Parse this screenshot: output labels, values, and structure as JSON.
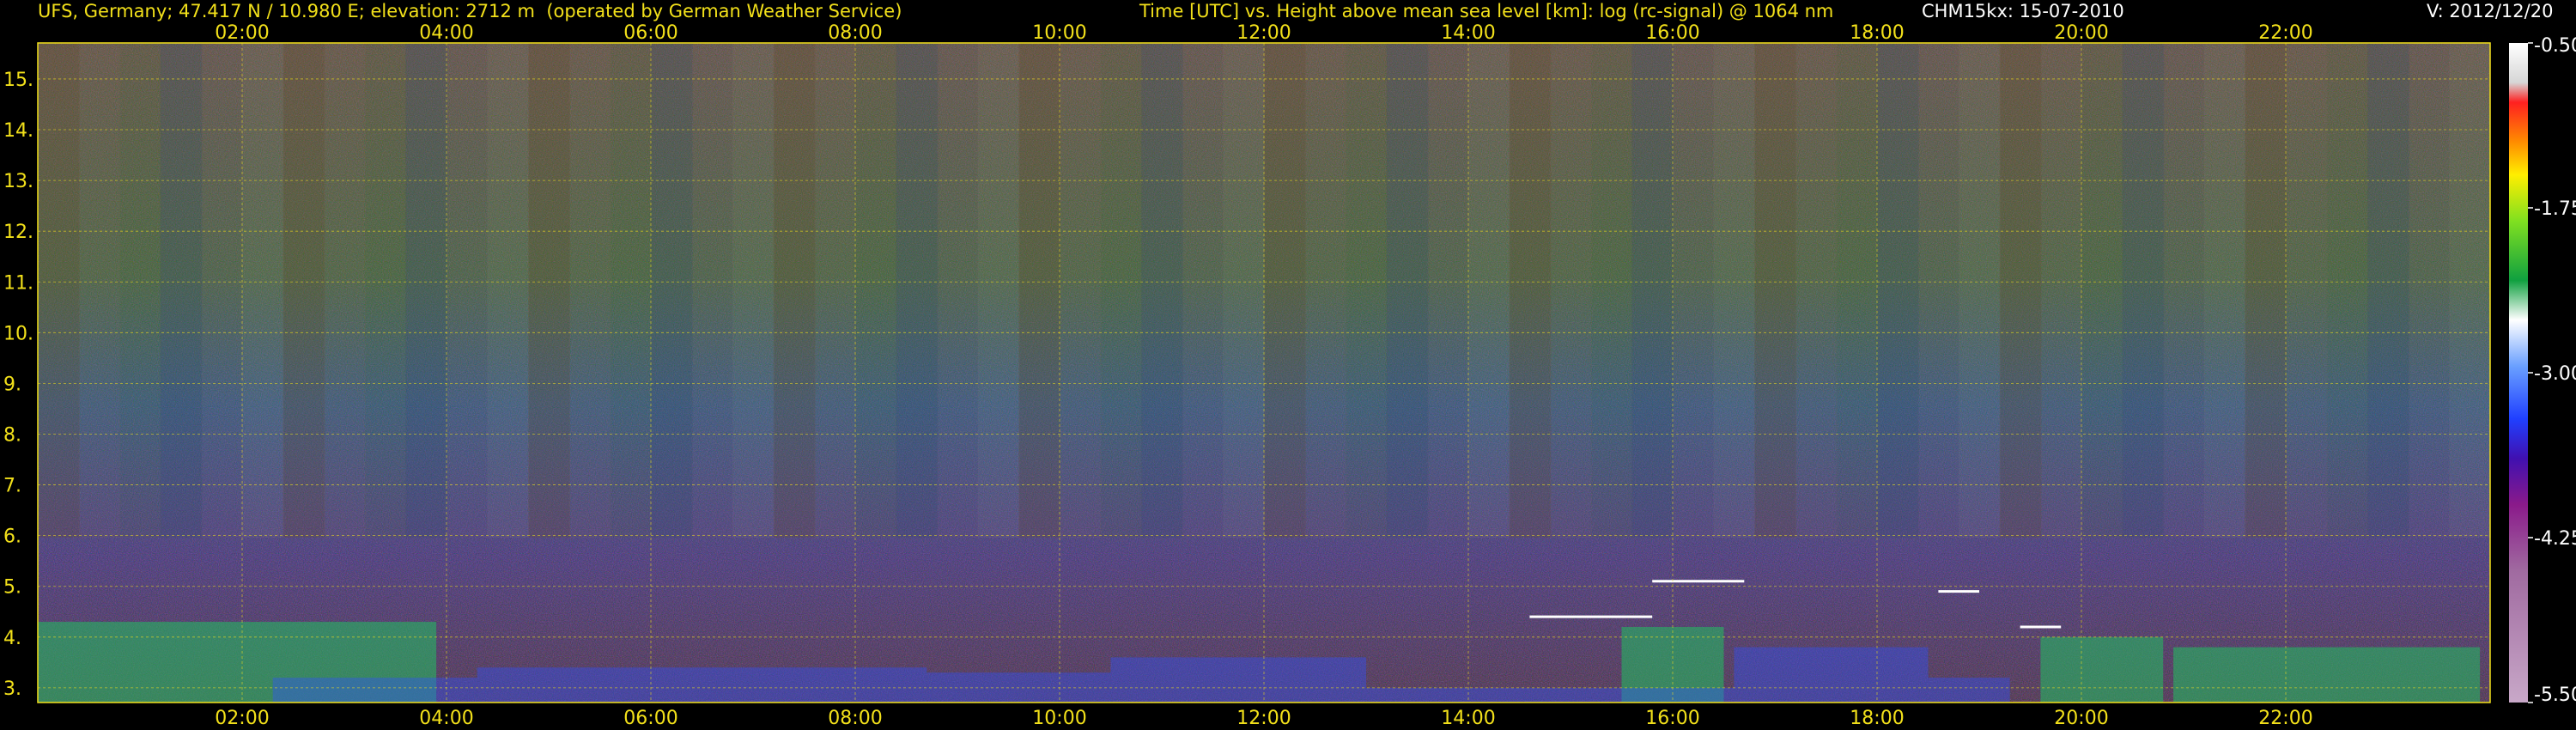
{
  "header": {
    "station": "UFS, Germany; 47.417 N / 10.980 E; elevation: 2712 m  (operated by German Weather Service)",
    "title": "Time [UTC] vs. Height above mean sea level [km]: log (rc-signal) @ 1064 nm",
    "instrument": "CHM15kx: 15-07-2010",
    "version": "V: 2012/12/20"
  },
  "colors": {
    "text": "#f2e01a",
    "frame": "#f2e01a",
    "background": "#000000"
  },
  "chart_data": {
    "type": "heatmap",
    "title": "Time [UTC] vs. Height above mean sea level [km]: log (rc-signal) @ 1064 nm",
    "x_unit": "hours UTC",
    "y_unit": "km",
    "xlim": [
      0.0,
      24.0
    ],
    "ylim": [
      2.71,
      15.71
    ],
    "x_ticks": [
      2,
      4,
      6,
      8,
      10,
      12,
      14,
      16,
      18,
      20,
      22
    ],
    "x_tick_labels": [
      "02:00",
      "04:00",
      "06:00",
      "08:00",
      "10:00",
      "12:00",
      "14:00",
      "16:00",
      "18:00",
      "20:00",
      "22:00"
    ],
    "y_ticks": [
      3,
      4,
      5,
      6,
      7,
      8,
      9,
      10,
      11,
      12,
      13,
      14,
      15
    ],
    "y_tick_labels": [
      "3.",
      "4.",
      "5.",
      "6.",
      "7.",
      "8.",
      "9.",
      "10.",
      "11.",
      "12.",
      "13.",
      "14.",
      "15."
    ],
    "colorbar": {
      "vmin": -5.5,
      "vmax": -0.5,
      "ticks": [
        -0.5,
        -1.75,
        -3.0,
        -4.25,
        -5.5
      ],
      "tick_labels": [
        "-0.50",
        "-1.75",
        "-3.00",
        "-4.25",
        "-5.50"
      ]
    },
    "features": {
      "low_clouds": [
        [
          0.0,
          3.9,
          4.3
        ],
        [
          19.6,
          20.8,
          4.0
        ],
        [
          20.9,
          23.9,
          3.8
        ],
        [
          15.5,
          16.5,
          4.2
        ]
      ],
      "cloud_tops": [
        [
          14.6,
          15.8,
          4.4
        ],
        [
          15.8,
          16.7,
          5.1
        ],
        [
          18.6,
          19.0,
          4.9
        ],
        [
          19.4,
          19.8,
          4.2
        ]
      ],
      "boundary_layer_top": [
        [
          2.3,
          4.3,
          3.2
        ],
        [
          4.3,
          8.7,
          3.4
        ],
        [
          8.7,
          10.5,
          3.3
        ],
        [
          10.5,
          13.0,
          3.6
        ],
        [
          13.0,
          16.6,
          3.0
        ],
        [
          16.6,
          18.5,
          3.8
        ],
        [
          18.5,
          19.3,
          3.2
        ]
      ]
    }
  }
}
